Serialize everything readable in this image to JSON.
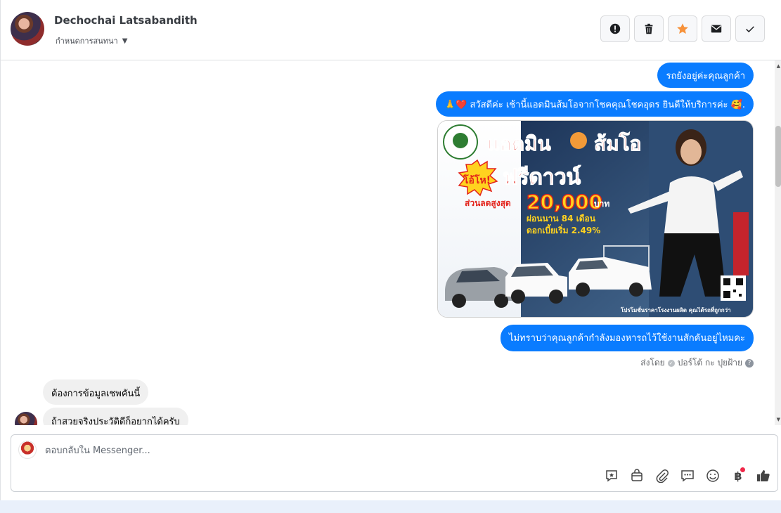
{
  "header": {
    "contact_name": "Dechochai Latsabandith",
    "assign_label": "กำหนดการสนทนา",
    "actions": [
      {
        "icon": "alert-icon",
        "label": "Mark as spam"
      },
      {
        "icon": "trash-icon",
        "label": "Delete"
      },
      {
        "icon": "star-icon",
        "label": "Star"
      },
      {
        "icon": "envelope-icon",
        "label": "Mark as unread"
      },
      {
        "icon": "check-icon",
        "label": "Mark as done"
      }
    ]
  },
  "messages": {
    "outgoing_1": "รถยังอยู่ค่ะคุณลูกค้า",
    "outgoing_2": "🙏❤️ สวัสดีค่ะ เช้านี้แอดมินส้มโอจากโชคคุณโชคอุดร ยินดีให้บริการค่ะ 🥰.",
    "outgoing_3": "ไม่ทราบว่าคุณลูกค้ากำลังมองหารถไว้ใช้งานสักคันอยู่ไหมคะ",
    "sent_by_prefix": "ส่งโดย",
    "sent_by_name": "ปอร์โต้ กะ ปุยฝ้าย",
    "incoming_1": "ต้องการข้อมูลเชพคันนี้",
    "incoming_2": "ถ้าสวยจริงประวัติดีก็อยากได้ครับ"
  },
  "promo_image": {
    "headline": "แอดมิน",
    "headline_name": "ส้มโอ",
    "badge": "โอ้โห!",
    "free_down": "ฟรีดาวน์",
    "discount_label": "ส่วนลดสูงสุด",
    "discount_value": "20,000",
    "discount_unit": "บาท",
    "installment": "ผ่อนนาน 84 เดือน",
    "interest": "ดอกเบี้ยเริ่ม 2.49%",
    "footer": "โปรโมชั่นราคาโรงงานผลิต คุณได้รถที่ถูกกว่า",
    "colors": {
      "accent_red": "#e3231b",
      "accent_yellow": "#ffd21f",
      "bg_dark": "#223a5e"
    }
  },
  "composer": {
    "placeholder": "ตอบกลับใน Messenger...",
    "tools": [
      "quick-reply-icon",
      "shop-bag-icon",
      "attachment-icon",
      "saved-replies-icon",
      "emoji-icon",
      "baht-icon",
      "thumbs-up-icon"
    ],
    "baht_symbol": "฿"
  },
  "colors": {
    "outgoing_bubble": "#0a7cff",
    "incoming_bubble": "#f0f0f0",
    "star_active": "#f7923a"
  }
}
